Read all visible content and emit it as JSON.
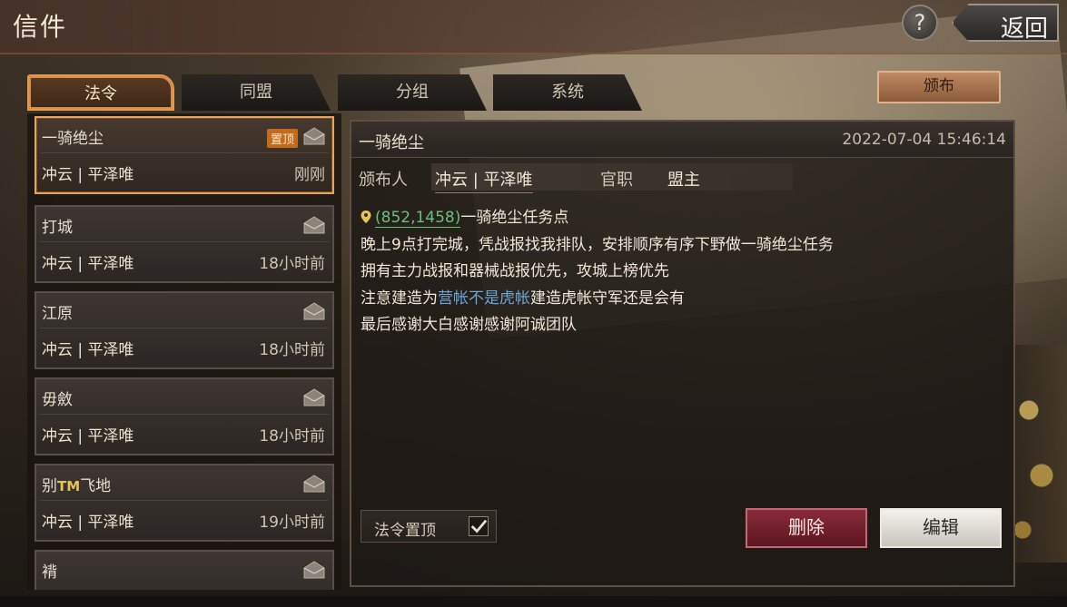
{
  "window": {
    "title": "信件",
    "help_label": "?",
    "back_label": "返回"
  },
  "tabs": [
    {
      "label": "法令",
      "active": true
    },
    {
      "label": "同盟",
      "active": false
    },
    {
      "label": "分组",
      "active": false
    },
    {
      "label": "系统",
      "active": false
    }
  ],
  "issue_button": "颁布",
  "list": [
    {
      "name": "一骑绝尘",
      "sender": "冲云 | 平泽唯",
      "time": "刚刚",
      "pinned_label": "置顶",
      "selected": true
    },
    {
      "name": "打城",
      "sender": "冲云 | 平泽唯",
      "time": "18小时前"
    },
    {
      "name": "江原",
      "sender": "冲云 | 平泽唯",
      "time": "18小时前"
    },
    {
      "name": "毋斂",
      "sender": "冲云 | 平泽唯",
      "time": "18小时前"
    },
    {
      "name_prefix": "别",
      "name_tm": "TM",
      "name_suffix": "飞地",
      "sender": "冲云 | 平泽唯",
      "time": "19小时前"
    },
    {
      "name": "褙"
    }
  ],
  "detail": {
    "title": "一骑绝尘",
    "timestamp": "2022-07-04 15:46:14",
    "issuer_label": "颁布人",
    "issuer": "冲云 | 平泽唯",
    "position_label": "官职",
    "position": "盟主",
    "coord": "(852,1458)",
    "line1_rest": "一骑绝尘任务点",
    "line2": "晚上9点打完城，凭战报找我排队，安排顺序有序下野做一骑绝尘任务",
    "line3": "拥有主力战报和器械战报优先，攻城上榜优先",
    "line4_a": "注意建造为",
    "line4_b": "营帐不是虎帐",
    "line4_c": "建造虎帐守军还是会有",
    "line5": "最后感谢大白感谢感谢阿诚团队",
    "pin_label": "法令置顶",
    "pin_checked": true,
    "delete_label": "删除",
    "edit_label": "编辑"
  },
  "colors": {
    "accent": "#e6a55c",
    "coord": "#69c07a",
    "highlight": "#6aa6d8",
    "delete": "#8a2a38"
  }
}
